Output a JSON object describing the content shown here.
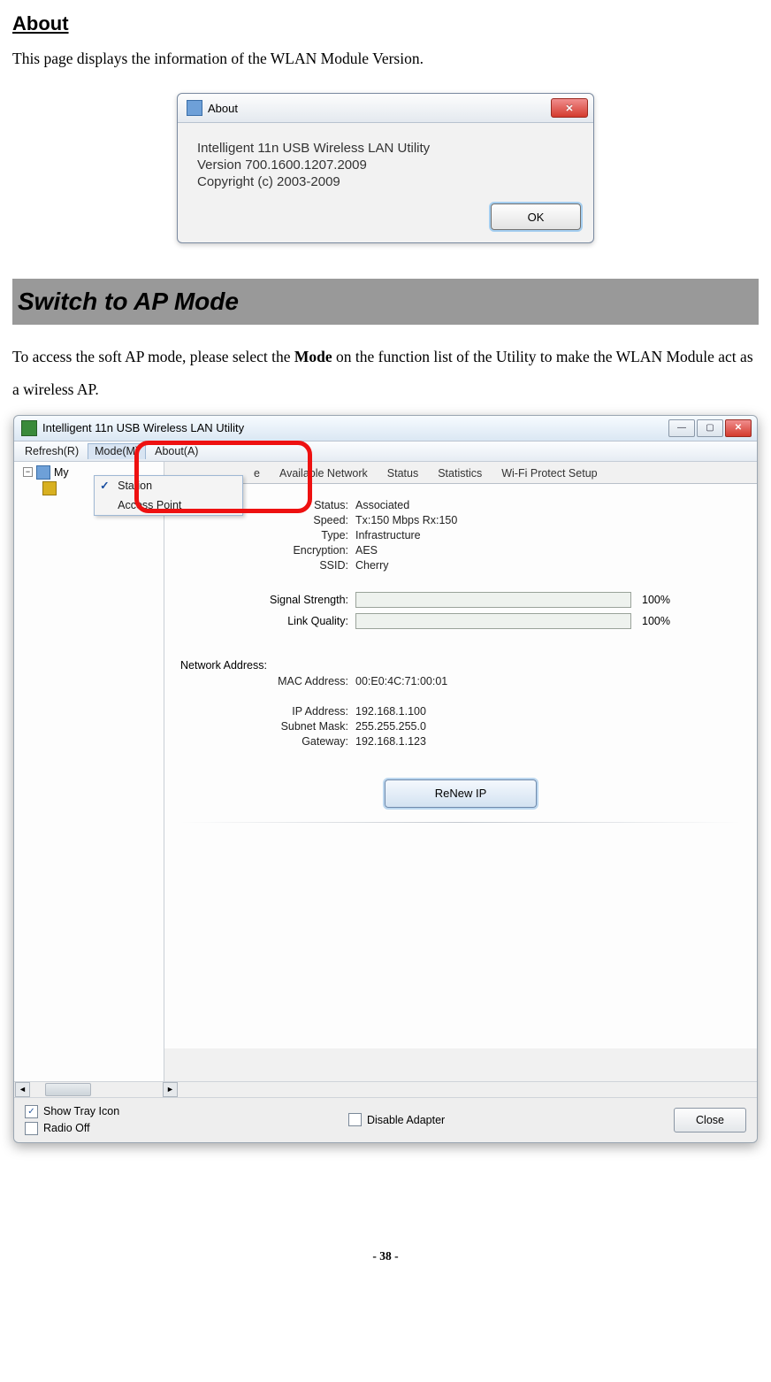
{
  "about_section": {
    "heading": "About",
    "intro": "This page displays the information of the WLAN Module Version."
  },
  "about_dialog": {
    "title": "About",
    "line1": "Intelligent 11n USB Wireless LAN Utility",
    "line2": "Version 700.1600.1207.2009",
    "line3": "Copyright (c) 2003-2009",
    "ok": "OK"
  },
  "switch_section": {
    "banner": "Switch to AP Mode",
    "para_pre": "To access the soft AP mode, please select the ",
    "para_bold": "Mode",
    "para_post": " on the function list of the Utility to make the WLAN Module act as a wireless AP."
  },
  "util": {
    "title": "Intelligent 11n USB Wireless LAN Utility",
    "menus": {
      "refresh": "Refresh(R)",
      "mode": "Mode(M)",
      "about": "About(A)"
    },
    "mode_menu": {
      "station": "Station",
      "ap": "Access Point"
    },
    "tree_root": "My",
    "tabs": {
      "general_partial": "e",
      "available": "Available Network",
      "status": "Status",
      "statistics": "Statistics",
      "wps": "Wi-Fi Protect Setup"
    },
    "fields": {
      "status_l": "Status:",
      "status_v": "Associated",
      "speed_l": "Speed:",
      "speed_v": "Tx:150 Mbps Rx:150",
      "type_l": "Type:",
      "type_v": "Infrastructure",
      "enc_l": "Encryption:",
      "enc_v": "AES",
      "ssid_l": "SSID:",
      "ssid_v": "Cherry",
      "sig_l": "Signal Strength:",
      "sig_v": "100%",
      "link_l": "Link Quality:",
      "link_v": "100%"
    },
    "netaddr": {
      "heading": "Network Address:",
      "mac_l": "MAC Address:",
      "mac_v": "00:E0:4C:71:00:01",
      "ip_l": "IP Address:",
      "ip_v": "192.168.1.100",
      "mask_l": "Subnet Mask:",
      "mask_v": "255.255.255.0",
      "gw_l": "Gateway:",
      "gw_v": "192.168.1.123"
    },
    "renew": "ReNew IP",
    "bottom": {
      "show_tray": "Show Tray Icon",
      "radio_off": "Radio Off",
      "disable_adapter": "Disable Adapter",
      "close": "Close"
    }
  },
  "page_number": "- 38 -"
}
